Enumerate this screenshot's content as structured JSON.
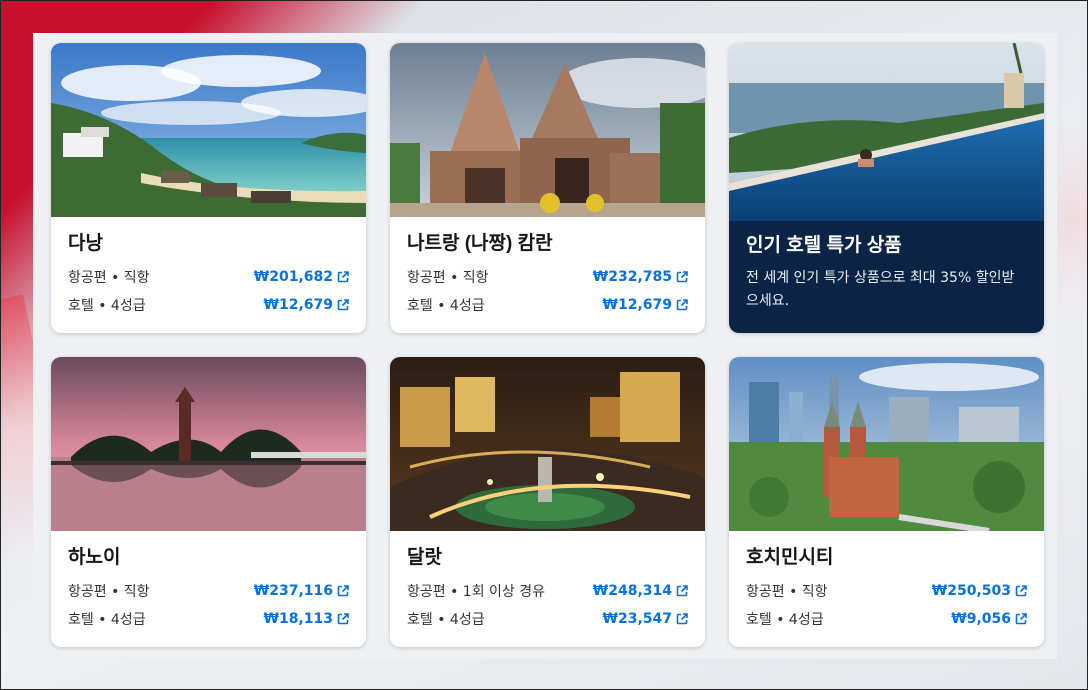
{
  "cards": [
    {
      "city": "다낭",
      "flight_label": "항공편 • 직항",
      "flight_price": "₩201,682",
      "hotel_label": "호텔 • 4성급",
      "hotel_price": "₩12,679"
    },
    {
      "city": "나트랑 (나짱) 캄란",
      "flight_label": "항공편 • 직항",
      "flight_price": "₩232,785",
      "hotel_label": "호텔 • 4성급",
      "hotel_price": "₩12,679"
    },
    {
      "city": "하노이",
      "flight_label": "항공편 • 직항",
      "flight_price": "₩237,116",
      "hotel_label": "호텔 • 4성급",
      "hotel_price": "₩18,113"
    },
    {
      "city": "달랏",
      "flight_label": "항공편 • 1회 이상 경유",
      "flight_price": "₩248,314",
      "hotel_label": "호텔 • 4성급",
      "hotel_price": "₩23,547"
    },
    {
      "city": "호치민시티",
      "flight_label": "항공편 • 직항",
      "flight_price": "₩250,503",
      "hotel_label": "호텔 • 4성급",
      "hotel_price": "₩9,056"
    }
  ],
  "promo": {
    "title": "인기 호텔 특가 상품",
    "description": "전 세계 인기 특가 상품으로 최대 35% 할인받으세요."
  },
  "colors": {
    "price_link": "#0770e3",
    "promo_bg": "#0b2445",
    "brand_red": "#c8102e"
  },
  "icons": {
    "price_link_icon": "external-link-icon"
  }
}
